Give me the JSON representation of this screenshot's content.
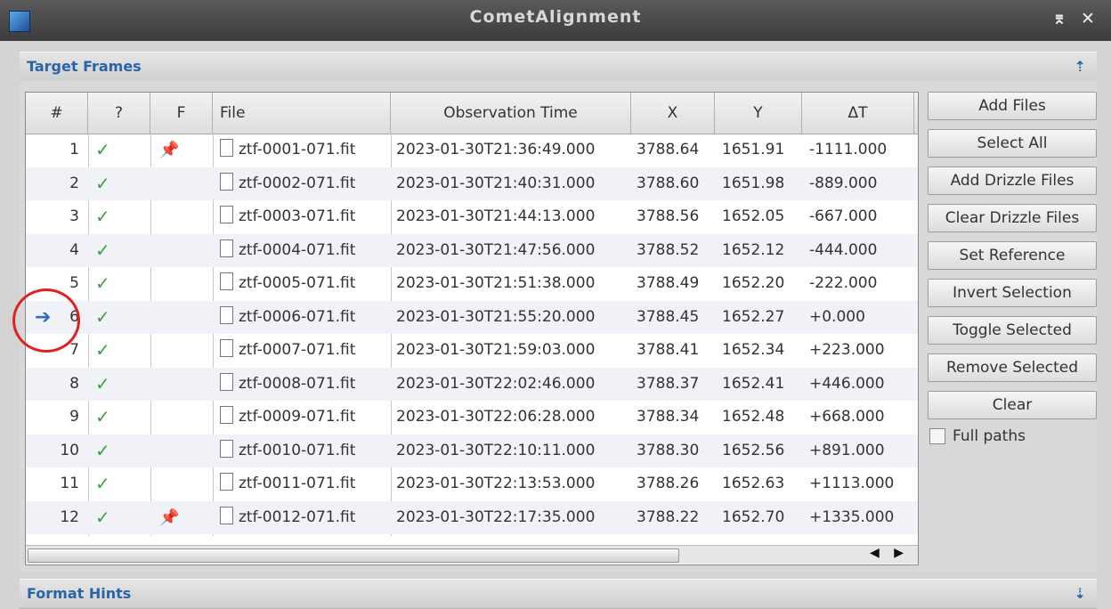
{
  "window": {
    "title": "CometAlignment",
    "pin_glyph": "⌆",
    "close_glyph": "✕"
  },
  "target_section": {
    "title": "Target Frames",
    "toggle_glyph": "⇡"
  },
  "format_section": {
    "title": "Format Hints",
    "toggle_glyph": "⇣"
  },
  "table": {
    "columns": [
      "#",
      "?",
      "F",
      "File",
      "Observation Time",
      "X",
      "Y",
      "ΔT"
    ],
    "rows": [
      {
        "n": "1",
        "ok": "✓",
        "pin": "📌",
        "file": "ztf-0001-071.fit",
        "time": "2023-01-30T21:36:49.000",
        "x": "3788.64",
        "y": "1651.91",
        "dt": "-1111.000",
        "ref": ""
      },
      {
        "n": "2",
        "ok": "✓",
        "pin": "",
        "file": "ztf-0002-071.fit",
        "time": "2023-01-30T21:40:31.000",
        "x": "3788.60",
        "y": "1651.98",
        "dt": "-889.000",
        "ref": ""
      },
      {
        "n": "3",
        "ok": "✓",
        "pin": "",
        "file": "ztf-0003-071.fit",
        "time": "2023-01-30T21:44:13.000",
        "x": "3788.56",
        "y": "1652.05",
        "dt": "-667.000",
        "ref": ""
      },
      {
        "n": "4",
        "ok": "✓",
        "pin": "",
        "file": "ztf-0004-071.fit",
        "time": "2023-01-30T21:47:56.000",
        "x": "3788.52",
        "y": "1652.12",
        "dt": "-444.000",
        "ref": ""
      },
      {
        "n": "5",
        "ok": "✓",
        "pin": "",
        "file": "ztf-0005-071.fit",
        "time": "2023-01-30T21:51:38.000",
        "x": "3788.49",
        "y": "1652.20",
        "dt": "-222.000",
        "ref": ""
      },
      {
        "n": "6",
        "ok": "✓",
        "pin": "",
        "file": "ztf-0006-071.fit",
        "time": "2023-01-30T21:55:20.000",
        "x": "3788.45",
        "y": "1652.27",
        "dt": "+0.000",
        "ref": "➔"
      },
      {
        "n": "7",
        "ok": "✓",
        "pin": "",
        "file": "ztf-0007-071.fit",
        "time": "2023-01-30T21:59:03.000",
        "x": "3788.41",
        "y": "1652.34",
        "dt": "+223.000",
        "ref": ""
      },
      {
        "n": "8",
        "ok": "✓",
        "pin": "",
        "file": "ztf-0008-071.fit",
        "time": "2023-01-30T22:02:46.000",
        "x": "3788.37",
        "y": "1652.41",
        "dt": "+446.000",
        "ref": ""
      },
      {
        "n": "9",
        "ok": "✓",
        "pin": "",
        "file": "ztf-0009-071.fit",
        "time": "2023-01-30T22:06:28.000",
        "x": "3788.34",
        "y": "1652.48",
        "dt": "+668.000",
        "ref": ""
      },
      {
        "n": "10",
        "ok": "✓",
        "pin": "",
        "file": "ztf-0010-071.fit",
        "time": "2023-01-30T22:10:11.000",
        "x": "3788.30",
        "y": "1652.56",
        "dt": "+891.000",
        "ref": ""
      },
      {
        "n": "11",
        "ok": "✓",
        "pin": "",
        "file": "ztf-0011-071.fit",
        "time": "2023-01-30T22:13:53.000",
        "x": "3788.26",
        "y": "1652.63",
        "dt": "+1113.000",
        "ref": ""
      },
      {
        "n": "12",
        "ok": "✓",
        "pin": "📌",
        "file": "ztf-0012-071.fit",
        "time": "2023-01-30T22:17:35.000",
        "x": "3788.22",
        "y": "1652.70",
        "dt": "+1335.000",
        "ref": ""
      }
    ]
  },
  "scroll": {
    "arrows": "◀ ▶"
  },
  "buttons": {
    "add_files": "Add Files",
    "select_all": "Select All",
    "add_drizzle": "Add Drizzle Files",
    "clear_drizzle": "Clear Drizzle Files",
    "set_reference": "Set Reference",
    "invert_selection": "Invert Selection",
    "toggle_selected": "Toggle Selected",
    "remove_selected": "Remove Selected",
    "clear": "Clear"
  },
  "full_paths": {
    "label": "Full paths",
    "checked": false
  },
  "colors": {
    "accent": "#2a64a8",
    "check": "#3aa33a",
    "annotation": "#e01f1f"
  }
}
